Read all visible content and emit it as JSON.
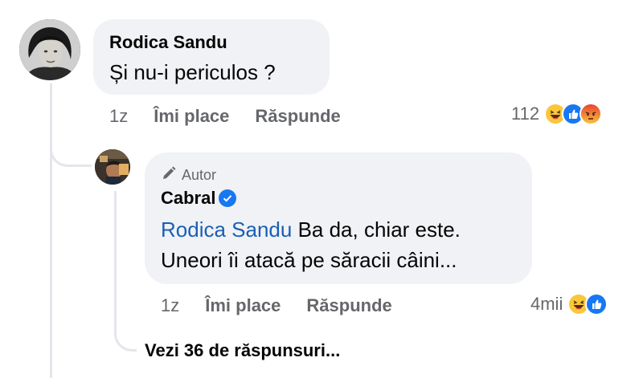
{
  "comment": {
    "author": "Rodica Sandu",
    "text": "Și nu-i periculos ?",
    "time": "1z",
    "like_label": "Îmi place",
    "reply_label": "Răspunde",
    "reaction_count": "112",
    "reactions": [
      "haha-icon",
      "like-icon",
      "angry-icon"
    ]
  },
  "reply": {
    "badge_label": "Autor",
    "author": "Cabral",
    "mention": "Rodica Sandu",
    "text_line1": " Ba da, chiar este.",
    "text_line2": "Uneori îi atacă pe săracii câini...",
    "time": "1z",
    "like_label": "Îmi place",
    "reply_label": "Răspunde",
    "reaction_count": "4mii",
    "reactions": [
      "haha-icon",
      "like-icon"
    ]
  },
  "view_replies": "Vezi 36 de răspunsuri...",
  "colors": {
    "bubble": "#f0f2f5",
    "muted_text": "#65676b",
    "mention": "#1a5fb4",
    "verified": "#1877f2",
    "thread_line": "#e4e6eb"
  }
}
